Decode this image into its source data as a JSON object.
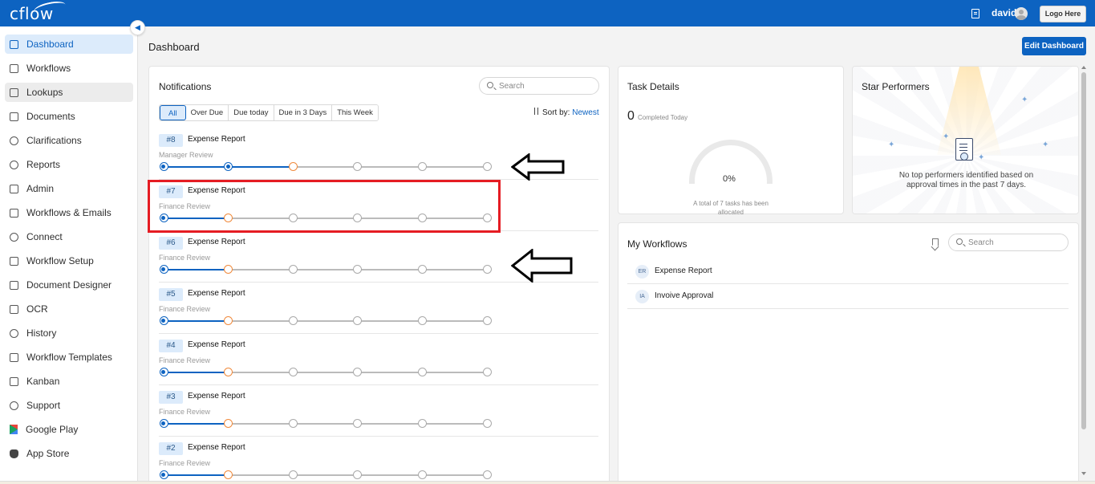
{
  "app": {
    "logo": "cflow",
    "user_name": "david",
    "logo_button": "Logo Here"
  },
  "sidebar": {
    "items": [
      {
        "label": "Dashboard",
        "icon": "dashboard-icon"
      },
      {
        "label": "Workflows",
        "icon": "workflows-icon"
      },
      {
        "label": "Lookups",
        "icon": "lookups-icon"
      },
      {
        "label": "Documents",
        "icon": "documents-icon"
      },
      {
        "label": "Clarifications",
        "icon": "clarifications-icon"
      },
      {
        "label": "Reports",
        "icon": "reports-icon"
      },
      {
        "label": "Admin",
        "icon": "admin-icon"
      },
      {
        "label": "Workflows & Emails",
        "icon": "mail-icon"
      },
      {
        "label": "Connect",
        "icon": "connect-icon"
      },
      {
        "label": "Workflow Setup",
        "icon": "sliders-icon"
      },
      {
        "label": "Document Designer",
        "icon": "designer-icon"
      },
      {
        "label": "OCR",
        "icon": "ocr-icon"
      },
      {
        "label": "History",
        "icon": "history-icon"
      },
      {
        "label": "Workflow Templates",
        "icon": "templates-icon"
      },
      {
        "label": "Kanban",
        "icon": "kanban-icon"
      },
      {
        "label": "Support",
        "icon": "support-icon"
      },
      {
        "label": "Google Play",
        "icon": "google-play-icon"
      },
      {
        "label": "App Store",
        "icon": "apple-icon"
      }
    ],
    "active_index": 0,
    "hover_index": 2
  },
  "header": {
    "title": "Dashboard",
    "edit_button": "Edit Dashboard"
  },
  "notifications": {
    "title": "Notifications",
    "search_placeholder": "Search",
    "filters": [
      "All",
      "Over Due",
      "Due today",
      "Due in 3 Days",
      "This Week"
    ],
    "selected_filter": "All",
    "sort_label": "Sort by:",
    "sort_value": "Newest",
    "rows": [
      {
        "id": "#8",
        "title": "Expense Report",
        "stage": "Manager Review",
        "steps_total": 6,
        "steps_done": 2,
        "current_step": 3
      },
      {
        "id": "#7",
        "title": "Expense Report",
        "stage": "Finance Review",
        "steps_total": 6,
        "steps_done": 1,
        "current_step": 2
      },
      {
        "id": "#6",
        "title": "Expense Report",
        "stage": "Finance Review",
        "steps_total": 6,
        "steps_done": 1,
        "current_step": 2
      },
      {
        "id": "#5",
        "title": "Expense Report",
        "stage": "Finance Review",
        "steps_total": 6,
        "steps_done": 1,
        "current_step": 2
      },
      {
        "id": "#4",
        "title": "Expense Report",
        "stage": "Finance Review",
        "steps_total": 6,
        "steps_done": 1,
        "current_step": 2
      },
      {
        "id": "#3",
        "title": "Expense Report",
        "stage": "Finance Review",
        "steps_total": 6,
        "steps_done": 1,
        "current_step": 2
      },
      {
        "id": "#2",
        "title": "Expense Report",
        "stage": "Finance Review",
        "steps_total": 6,
        "steps_done": 1,
        "current_step": 2
      }
    ]
  },
  "task_details": {
    "title": "Task Details",
    "completed_count": "0",
    "completed_label": "Completed Today",
    "percent": "0%",
    "note": "A total of 7 tasks has been allocated"
  },
  "star_performers": {
    "title": "Star Performers",
    "message": "No top performers identified based on approval times in the past 7 days."
  },
  "my_workflows": {
    "title": "My Workflows",
    "search_placeholder": "Search",
    "items": [
      {
        "badge": "ER",
        "label": "Expense Report"
      },
      {
        "badge": "IA",
        "label": "Invoive Approval"
      }
    ]
  },
  "colors": {
    "brand": "#0d63c1",
    "current_step": "#f08a3c",
    "annotation": "#e51c23"
  }
}
